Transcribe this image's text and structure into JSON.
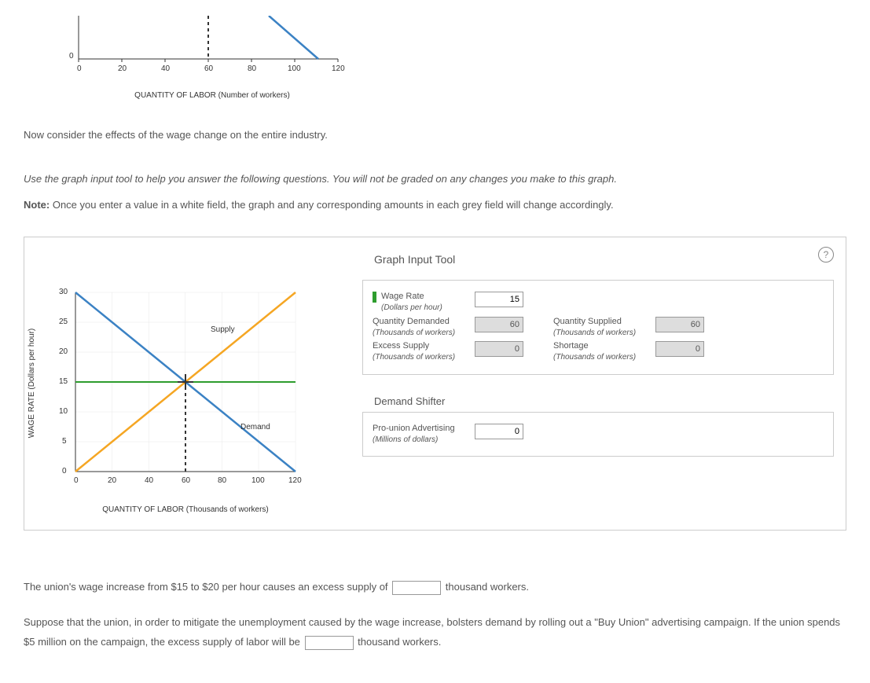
{
  "top_chart": {
    "y_ticks": [
      "0"
    ],
    "x_ticks": [
      "0",
      "20",
      "40",
      "60",
      "80",
      "100",
      "120"
    ],
    "x_label": "QUANTITY OF LABOR (Number of workers)"
  },
  "intro1": "Now consider the effects of the wage change on the entire industry.",
  "intro2": "Use the graph input tool to help you answer the following questions. You will not be graded on any changes you make to this graph.",
  "intro3_prefix": "Note:",
  "intro3": " Once you enter a value in a white field, the graph and any corresponding amounts in each grey field will change accordingly.",
  "main_chart": {
    "y_label": "WAGE RATE (Dollars per hour)",
    "x_label": "QUANTITY OF LABOR (Thousands of workers)",
    "y_ticks": [
      "0",
      "5",
      "10",
      "15",
      "20",
      "25",
      "30"
    ],
    "x_ticks": [
      "0",
      "20",
      "40",
      "60",
      "80",
      "100",
      "120"
    ],
    "supply_label": "Supply",
    "demand_label": "Demand"
  },
  "tool": {
    "title": "Graph Input Tool",
    "wage_rate_label": "Wage Rate",
    "wage_rate_sub": "(Dollars per hour)",
    "wage_rate_value": "15",
    "qd_label": "Quantity Demanded",
    "qd_sub": "(Thousands of workers)",
    "qd_value": "60",
    "qs_label": "Quantity Supplied",
    "qs_sub": "(Thousands of workers)",
    "qs_value": "60",
    "excess_label": "Excess Supply",
    "excess_sub": "(Thousands of workers)",
    "excess_value": "0",
    "shortage_label": "Shortage",
    "shortage_sub": "(Thousands of workers)",
    "shortage_value": "0",
    "shifter_title": "Demand Shifter",
    "adv_label": "Pro-union Advertising",
    "adv_sub": "(Millions of dollars)",
    "adv_value": "0"
  },
  "q1_pre": "The union's wage increase from $15 to $20 per hour causes an excess supply of ",
  "q1_post": " thousand workers.",
  "q2a": "Suppose that the union, in order to mitigate the unemployment caused by the wage increase, bolsters demand by rolling out a \"Buy Union\" advertising campaign. If the union spends $5 million on the campaign, the excess supply of labor will be ",
  "q2b": " thousand workers.",
  "chart_data": [
    {
      "type": "line",
      "title": "Top chart (partial visible)",
      "xlabel": "QUANTITY OF LABOR (Number of workers)",
      "ylabel": "",
      "xlim": [
        0,
        120
      ],
      "ylim": [
        0,
        10
      ],
      "series": [
        {
          "name": "Demand-fragment",
          "x": [
            88,
            110
          ],
          "y": [
            10,
            0
          ]
        },
        {
          "name": "Dashed-vertical",
          "x": [
            60,
            60
          ],
          "y": [
            0,
            10
          ]
        }
      ]
    },
    {
      "type": "line",
      "title": "Industry labor market",
      "xlabel": "QUANTITY OF LABOR (Thousands of workers)",
      "ylabel": "WAGE RATE (Dollars per hour)",
      "xlim": [
        0,
        120
      ],
      "ylim": [
        0,
        30
      ],
      "series": [
        {
          "name": "Supply",
          "x": [
            0,
            120
          ],
          "y": [
            0,
            30
          ]
        },
        {
          "name": "Demand",
          "x": [
            0,
            120
          ],
          "y": [
            30,
            0
          ]
        },
        {
          "name": "Equilibrium wage",
          "x": [
            0,
            120
          ],
          "y": [
            15,
            15
          ]
        },
        {
          "name": "Dashed-vertical",
          "x": [
            60,
            60
          ],
          "y": [
            0,
            15
          ]
        }
      ],
      "equilibrium": {
        "x": 60,
        "y": 15
      }
    }
  ]
}
